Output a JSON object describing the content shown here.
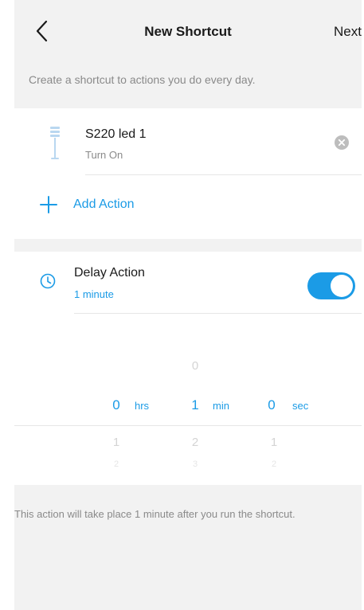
{
  "header": {
    "title": "New Shortcut",
    "next_label": "Next",
    "back_icon": "chevron-left-icon"
  },
  "subtitle": "Create a shortcut to actions you do every day.",
  "actions": {
    "items": [
      {
        "device_name": "S220 led 1",
        "state": "Turn On",
        "icon": "lamp-icon"
      }
    ],
    "add_label": "Add Action"
  },
  "delay": {
    "title": "Delay Action",
    "value": "1 minute",
    "enabled": true,
    "picker": {
      "hours": {
        "above": "",
        "selected": "0",
        "unit": "hrs",
        "below1": "1",
        "below2": "2"
      },
      "minutes": {
        "above": "0",
        "selected": "1",
        "unit": "min",
        "below1": "2",
        "below2": "3"
      },
      "seconds": {
        "above": "",
        "selected": "0",
        "unit": "sec",
        "below1": "1",
        "below2": "2"
      }
    }
  },
  "footer_note": "This action will take place 1 minute after you run the shortcut.",
  "colors": {
    "accent": "#1b9be6",
    "background": "#f2f2f2",
    "card": "#ffffff",
    "secondary_text": "#8a8a8a"
  }
}
